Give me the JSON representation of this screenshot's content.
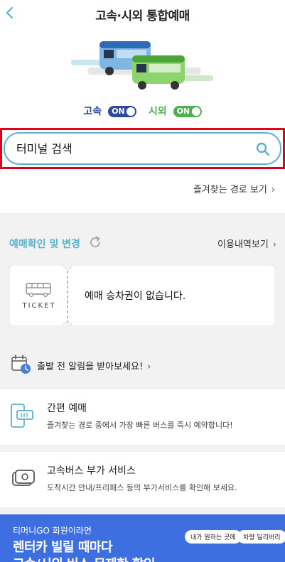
{
  "header": {
    "title": "고속·시외 통합예매"
  },
  "toggles": {
    "express_label": "고속",
    "express_state": "ON",
    "intercity_label": "시외",
    "intercity_state": "ON"
  },
  "search": {
    "placeholder": "터미널 검색"
  },
  "favorites": {
    "link": "즐겨찾는 경로 보기"
  },
  "reservation": {
    "title": "예매확인 및 변경",
    "history_link": "이용내역보기",
    "ticket_word": "TICKET",
    "empty_message": "예매 승차권이 없습니다."
  },
  "alarm": {
    "text": "출발 전 알림을 받아보세요!"
  },
  "cards": [
    {
      "title": "간편 예매",
      "desc": "즐겨찾는 경로 중에서 가장 빠른 버스를 즉시 예약합니다!"
    },
    {
      "title": "고속버스 부가 서비스",
      "desc": "도착시간 안내/프리패스 등의 부가서비스를 확인해 보세요."
    }
  ],
  "banner": {
    "sub": "티머니GO 회원이라면",
    "line1": "렌터카 빌릴 때마다",
    "line2": "고속/시외 버스 무제한 할인",
    "bubble1": "내가 원하는 곳에",
    "bubble2": "차량 딜리버리"
  },
  "colors": {
    "accent": "#5ab2cc",
    "express": "#2d4a9a",
    "intercity": "#4caf50",
    "highlight": "#e1001a",
    "banner": "#3d6fe0"
  }
}
